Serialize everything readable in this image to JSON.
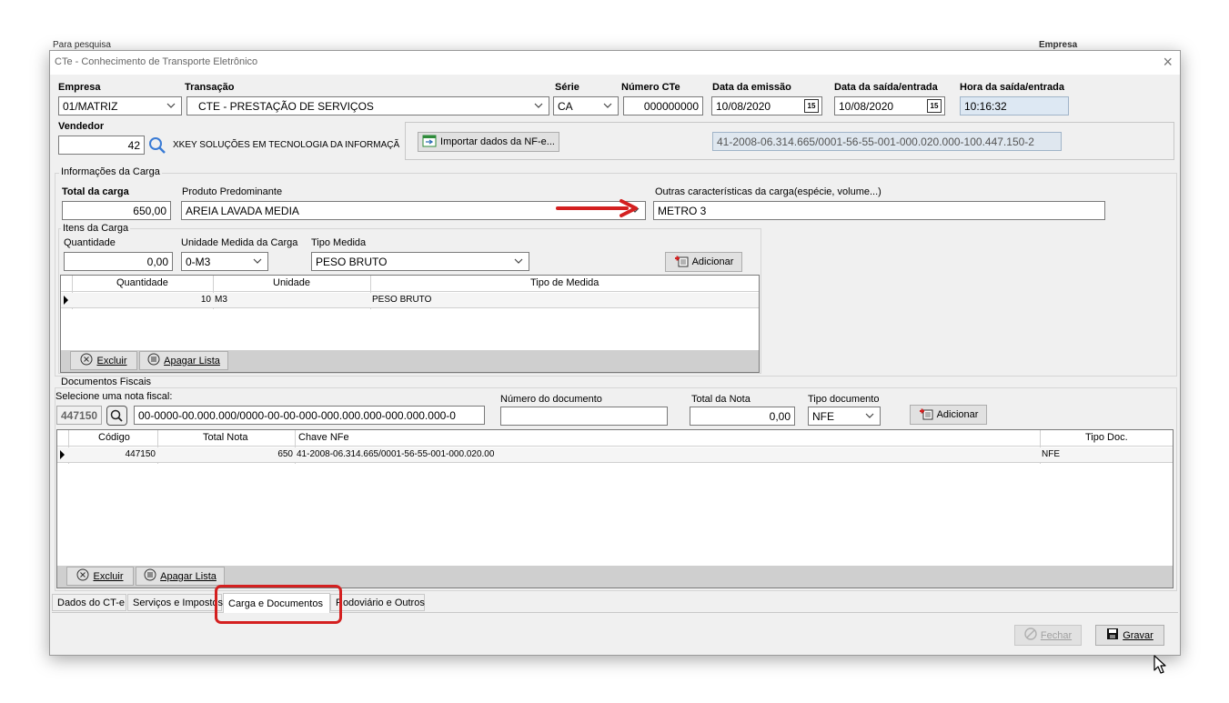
{
  "background": {
    "left_partial": "Para pesquisa",
    "right_partial": "Empresa"
  },
  "window": {
    "title": "CTe - Conhecimento de Transporte Eletrônico",
    "close_glyph": "×"
  },
  "header": {
    "empresa_label": "Empresa",
    "empresa_value": "01/MATRIZ",
    "transacao_label": "Transação",
    "transacao_value": "CTE - PRESTAÇÃO DE SERVIÇOS",
    "serie_label": "Série",
    "serie_value": "CA",
    "numero_label": "Número CTe",
    "numero_value": "000000000",
    "emissao_label": "Data da emissão",
    "emissao_value": "10/08/2020",
    "saida_label": "Data da saída/entrada",
    "saida_value": "10/08/2020",
    "hora_label": "Hora da saída/entrada",
    "hora_value": "10:16:32",
    "calendar_glyph": "15",
    "vendedor_label": "Vendedor",
    "vendedor_value": "42",
    "vendedor_name": "XKEY SOLUÇÕES EM TECNOLOGIA DA INFORMAÇÃ",
    "importar_label": "Importar dados da NF-e...",
    "chave_value": "41-2008-06.314.665/0001-56-55-001-000.020.000-100.447.150-2"
  },
  "carga": {
    "group_title": "Informações da Carga",
    "total_label": "Total da carga",
    "total_value": "650,00",
    "produto_label": "Produto Predominante",
    "produto_value": "AREIA LAVADA MEDIA",
    "outras_label": "Outras características da carga(espécie, volume...)",
    "outras_value": "METRO 3"
  },
  "itens": {
    "group_title": "Itens da Carga",
    "quantidade_label": "Quantidade",
    "quantidade_value": "0,00",
    "unidade_label": "Unidade Medida da Carga",
    "unidade_value": "0-M3",
    "tipo_label": "Tipo Medida",
    "tipo_value": "PESO BRUTO",
    "adicionar_label": "Adicionar",
    "columns": [
      "Quantidade",
      "Unidade",
      "Tipo de Medida"
    ],
    "rows": [
      {
        "quantidade": "10",
        "unidade": "M3",
        "tipo": "PESO BRUTO"
      }
    ],
    "excluir_label": "Excluir",
    "apagar_label": "Apagar Lista"
  },
  "documentos": {
    "group_title": "Documentos Fiscais",
    "selecione_label": "Selecione uma nota fiscal:",
    "nota_code": "447150",
    "nota_chave": "00-0000-00.000.000/0000-00-00-000-000.000.000-000.000.000-0",
    "numero_label": "Número do documento",
    "numero_value": "",
    "total_label": "Total da Nota",
    "total_value": "0,00",
    "tipo_label": "Tipo documento",
    "tipo_value": "NFE",
    "adicionar_label": "Adicionar",
    "columns": [
      "Código",
      "Total Nota",
      "Chave NFe",
      "Tipo Doc."
    ],
    "rows": [
      {
        "codigo": "447150",
        "total": "650",
        "chave": "41-2008-06.314.665/0001-56-55-001-000.020.00",
        "tipo": "NFE"
      }
    ],
    "excluir_label": "Excluir",
    "apagar_label": "Apagar Lista"
  },
  "tabs": [
    {
      "label": "Dados do CT-e"
    },
    {
      "label": "Serviços e Impostos"
    },
    {
      "label": "Carga e Documentos"
    },
    {
      "label": "Rodoviário e Outros"
    }
  ],
  "footer": {
    "fechar_label": "Fechar",
    "gravar_label": "Gravar"
  },
  "colors": {
    "annotation_red": "#d42020",
    "readonly_bg": "#dde8f3"
  }
}
